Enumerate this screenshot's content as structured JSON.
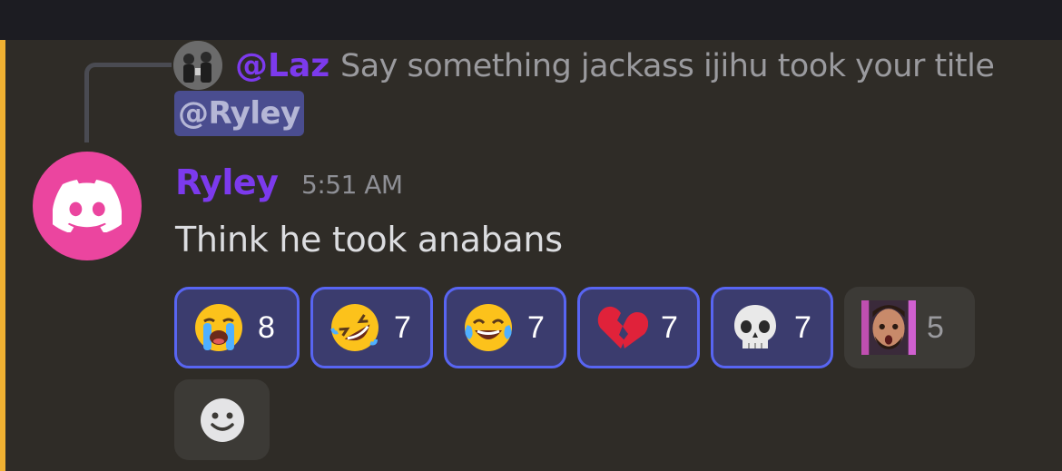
{
  "reply": {
    "author": "@Laz",
    "text": "Say something jackass ijihu took your title",
    "mention": "@Ryley",
    "avatar_icon": "group-photo-avatar"
  },
  "message": {
    "author": "Ryley",
    "timestamp": "5:51 AM",
    "text": "Think he took anabans",
    "avatar_icon": "discord-logo-icon"
  },
  "reactions": [
    {
      "emoji": "loudly-crying-face",
      "count": "8",
      "active": true
    },
    {
      "emoji": "rolling-on-floor-laughing",
      "count": "7",
      "active": true
    },
    {
      "emoji": "face-with-tears-of-joy",
      "count": "7",
      "active": true
    },
    {
      "emoji": "broken-heart",
      "count": "7",
      "active": true
    },
    {
      "emoji": "skull",
      "count": "7",
      "active": true
    },
    {
      "emoji": "custom-face-emoji",
      "count": "5",
      "active": false
    }
  ],
  "add_reaction_icon": "smiley-add-reaction-icon",
  "colors": {
    "background": "#2f2c27",
    "accent_bar": "#f0b132",
    "author": "#7c3aed",
    "active_reaction_bg": "#3b3c6e",
    "active_reaction_border": "#5865f2",
    "avatar_bg": "#eb459f"
  }
}
